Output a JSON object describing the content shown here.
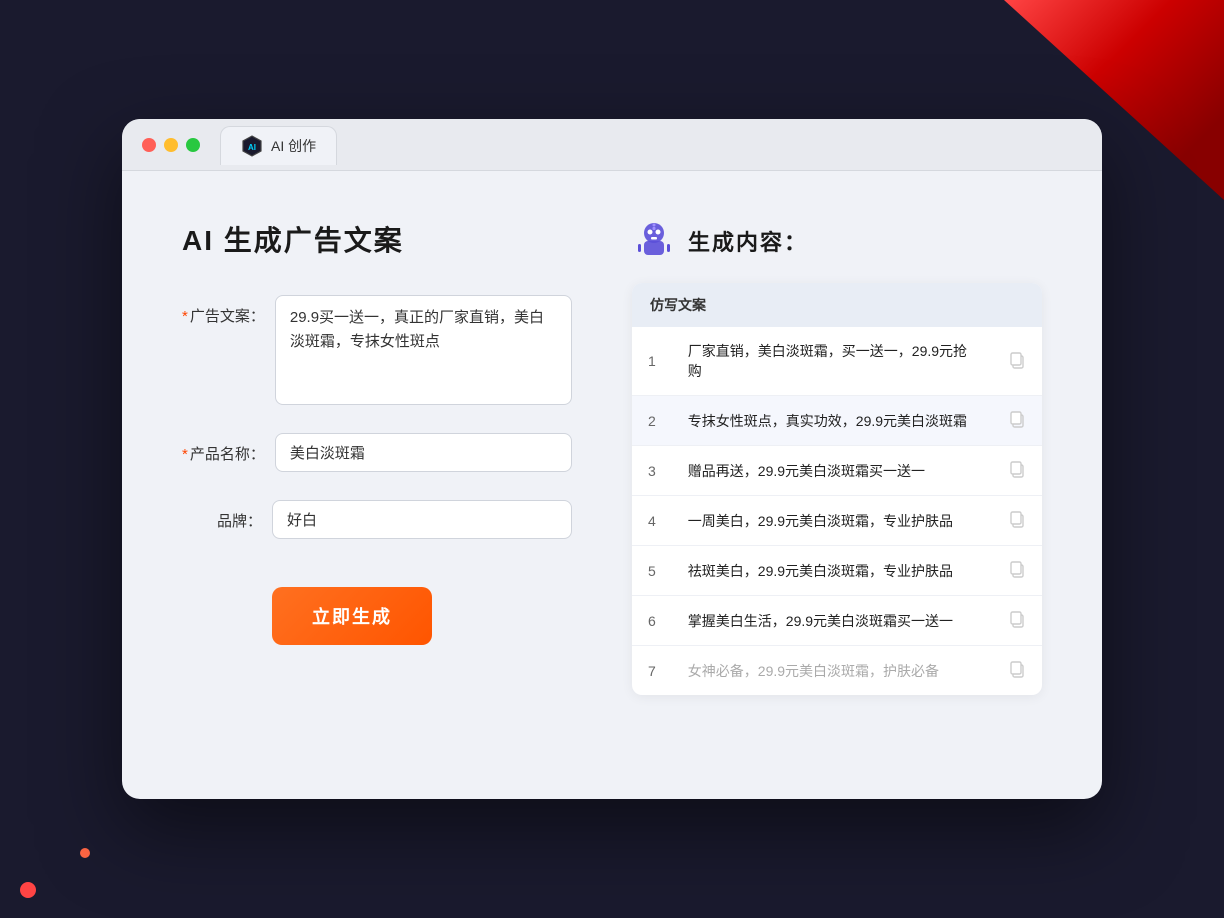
{
  "browser": {
    "tab_label": "AI 创作"
  },
  "page": {
    "title": "AI 生成广告文案",
    "result_heading": "生成内容："
  },
  "form": {
    "ad_copy_label": "广告文案：",
    "ad_copy_required": "*",
    "ad_copy_value": "29.9买一送一，真正的厂家直销，美白淡斑霜，专抹女性斑点",
    "product_name_label": "产品名称：",
    "product_name_required": "*",
    "product_name_value": "美白淡斑霜",
    "brand_label": "品牌：",
    "brand_value": "好白",
    "submit_label": "立即生成"
  },
  "results": {
    "section_label": "仿写文案",
    "items": [
      {
        "num": "1",
        "text": "厂家直销，美白淡斑霜，买一送一，29.9元抢购",
        "muted": false
      },
      {
        "num": "2",
        "text": "专抹女性斑点，真实功效，29.9元美白淡斑霜",
        "muted": false
      },
      {
        "num": "3",
        "text": "赠品再送，29.9元美白淡斑霜买一送一",
        "muted": false
      },
      {
        "num": "4",
        "text": "一周美白，29.9元美白淡斑霜，专业护肤品",
        "muted": false
      },
      {
        "num": "5",
        "text": "祛斑美白，29.9元美白淡斑霜，专业护肤品",
        "muted": false
      },
      {
        "num": "6",
        "text": "掌握美白生活，29.9元美白淡斑霜买一送一",
        "muted": false
      },
      {
        "num": "7",
        "text": "女神必备，29.9元美白淡斑霜，护肤必备",
        "muted": true
      }
    ]
  }
}
